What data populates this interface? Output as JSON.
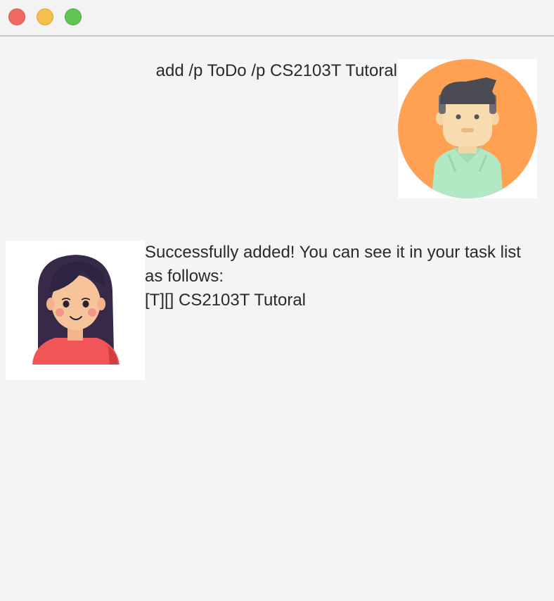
{
  "window": {
    "controls": {
      "close": "close-button",
      "minimize": "minimize-button",
      "zoom": "zoom-button"
    },
    "colors": {
      "close": "#ee6a5f",
      "minimize": "#f5bf4f",
      "zoom": "#61c554"
    }
  },
  "dialog": {
    "user": {
      "text": "add /p ToDo /p CS2103T Tutoral",
      "avatar": "male-user-avatar",
      "avatar_bg": "#ffa152"
    },
    "bot": {
      "text": "Successfully added! You can see it in your task list as follows:\n[T][] CS2103T Tutoral",
      "avatar": "female-bot-avatar"
    }
  }
}
